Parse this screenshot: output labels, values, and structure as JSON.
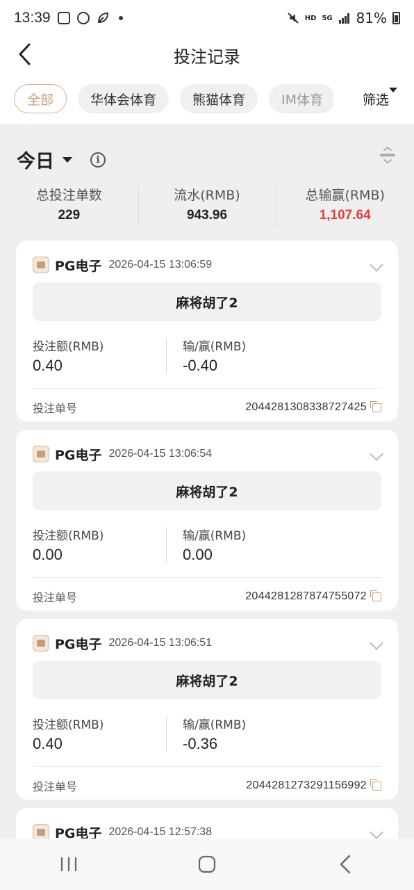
{
  "status_bar": {
    "time": "13:39",
    "network_label": "HD",
    "signal_label": "5G",
    "battery_percent": "81%",
    "icons": [
      "photo-icon",
      "speed-icon",
      "leaf-icon",
      "dot-icon",
      "mute-icon",
      "signal-icon",
      "battery-icon"
    ]
  },
  "header": {
    "title": "投注记录",
    "back_icon": "chevron-left-icon"
  },
  "tabs": [
    {
      "label": "全部",
      "active": true
    },
    {
      "label": "华体会体育",
      "active": false
    },
    {
      "label": "熊猫体育",
      "active": false
    },
    {
      "label": "IM体育",
      "active": false
    }
  ],
  "filter": {
    "label": "筛选"
  },
  "summary": {
    "period": "今日",
    "stats": [
      {
        "label": "总投注单数",
        "value": "229"
      },
      {
        "label": "流水(RMB)",
        "value": "943.96"
      },
      {
        "label": "总输赢(RMB)",
        "value": "1,107.64",
        "color": "#e43b3b"
      }
    ]
  },
  "records": [
    {
      "provider": "PG电子",
      "time": "2026-04-15 13:06:59",
      "game": "麻将胡了2",
      "bet_label": "投注额(RMB)",
      "bet_amount": "0.40",
      "winloss_label": "输/赢(RMB)",
      "winloss": "-0.40",
      "order_label": "投注单号",
      "order_no": "2044281308338727425"
    },
    {
      "provider": "PG电子",
      "time": "2026-04-15 13:06:54",
      "game": "麻将胡了2",
      "bet_label": "投注额(RMB)",
      "bet_amount": "0.00",
      "winloss_label": "输/赢(RMB)",
      "winloss": "0.00",
      "order_label": "投注单号",
      "order_no": "2044281287874755072"
    },
    {
      "provider": "PG电子",
      "time": "2026-04-15 13:06:51",
      "game": "麻将胡了2",
      "bet_label": "投注额(RMB)",
      "bet_amount": "0.40",
      "winloss_label": "输/赢(RMB)",
      "winloss": "-0.36",
      "order_label": "投注单号",
      "order_no": "2044281273291156992"
    },
    {
      "provider": "PG电子",
      "time": "2026-04-15 12:57:38"
    }
  ],
  "nav_bar": {
    "icons": [
      "recent-apps-icon",
      "home-icon",
      "back-icon"
    ]
  }
}
